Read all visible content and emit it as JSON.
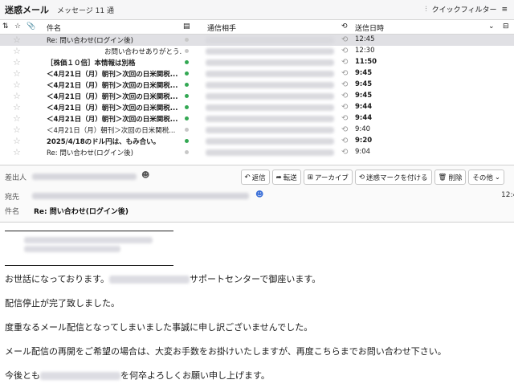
{
  "folder": {
    "title": "迷惑メール",
    "count": "メッセージ 11 通"
  },
  "quick_filter": "クイックフィルター",
  "columns": {
    "subject": "件名",
    "correspondent": "通信相手",
    "date": "送信日時"
  },
  "messages": [
    {
      "subject": "Re: 問い合わせ(ログイン後)",
      "date": "12:45",
      "bold": false,
      "selected": true,
      "dot": "#c8c8c8"
    },
    {
      "subject": "お問い合わせありがとう...",
      "date": "12:30",
      "bold": false,
      "selected": false,
      "dot": "#c8c8c8"
    },
    {
      "subject": "［株価１０倍］本情報は別格",
      "date": "11:50",
      "bold": true,
      "selected": false,
      "dot": "#33a853"
    },
    {
      "subject": "＜4月21日（月）朝刊＞次回の日米関税...",
      "date": "9:45",
      "bold": true,
      "selected": false,
      "dot": "#33a853"
    },
    {
      "subject": "＜4月21日（月）朝刊＞次回の日米関税...",
      "date": "9:45",
      "bold": true,
      "selected": false,
      "dot": "#33a853"
    },
    {
      "subject": "＜4月21日（月）朝刊＞次回の日米関税...",
      "date": "9:45",
      "bold": true,
      "selected": false,
      "dot": "#33a853"
    },
    {
      "subject": "＜4月21日（月）朝刊＞次回の日米関税...",
      "date": "9:44",
      "bold": true,
      "selected": false,
      "dot": "#33a853"
    },
    {
      "subject": "＜4月21日（月）朝刊＞次回の日米関税...",
      "date": "9:44",
      "bold": true,
      "selected": false,
      "dot": "#33a853"
    },
    {
      "subject": "＜4月21日（月）朝刊＞次回の日米関税...",
      "date": "9:40",
      "bold": false,
      "selected": false,
      "dot": "#c8c8c8"
    },
    {
      "subject": "2025/4/18のドル円は、もみ合い。",
      "date": "9:20",
      "bold": true,
      "selected": false,
      "dot": "#33a853"
    },
    {
      "subject": "Re: 問い合わせ(ログイン後)",
      "date": "9:04",
      "bold": false,
      "selected": false,
      "dot": "#c8c8c8"
    }
  ],
  "header": {
    "from_label": "差出人",
    "to_label": "宛先",
    "subject_label": "件名",
    "subject": "Re: 問い合わせ(ログイン後)",
    "time": "12:4",
    "buttons": {
      "reply": "返信",
      "forward": "転送",
      "archive": "アーカイブ",
      "junk": "迷惑マークを付ける",
      "delete": "削除",
      "more": "その他"
    }
  },
  "body": {
    "p1a": "お世話になっております。",
    "p1b": "サポートセンターで御座います。",
    "p2": "配信停止が完了致しました。",
    "p3": "度重なるメール配信となってしまいました事誠に申し訳ございませんでした。",
    "p4": "メール配信の再開をご希望の場合は、大変お手数をお掛けいたしますが、再度こちらまでお問い合わせ下さい。",
    "p5a": "今後とも",
    "p5b": "を何卒よろしくお願い申し上げます。"
  }
}
